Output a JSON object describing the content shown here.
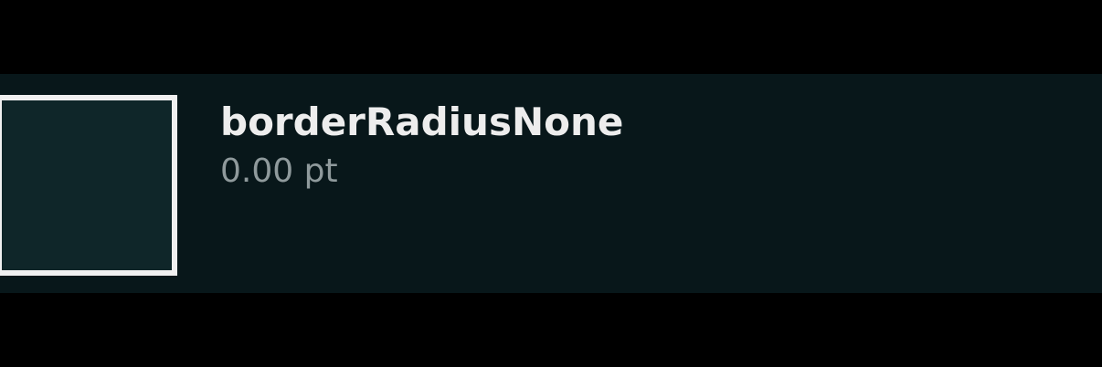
{
  "token": {
    "name": "borderRadiusNone",
    "value": "0.00 pt"
  },
  "colors": {
    "background": "#000000",
    "row_background": "#08171a",
    "swatch_fill": "#0f2629",
    "swatch_border": "#f0f0f0",
    "name_text": "#ededed",
    "value_text": "#8f9a9c"
  }
}
